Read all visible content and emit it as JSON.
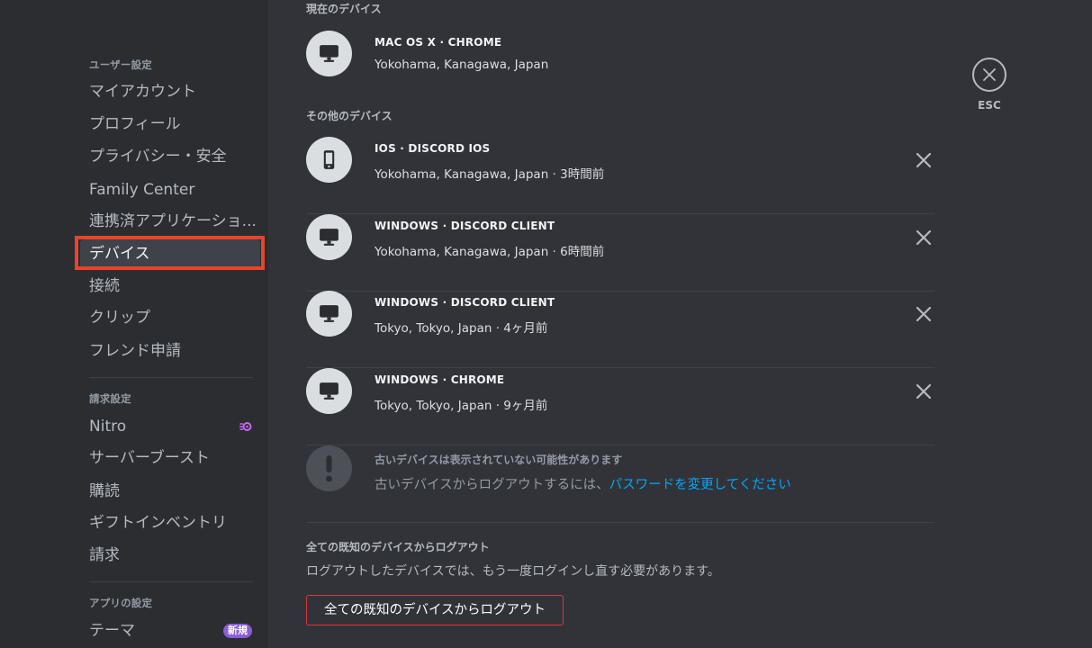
{
  "sidebar": {
    "user_settings_header": "ユーザー設定",
    "user_items": [
      {
        "label": "マイアカウント"
      },
      {
        "label": "プロフィール"
      },
      {
        "label": "プライバシー・安全"
      },
      {
        "label": "Family Center"
      },
      {
        "label": "連携済アプリケーショ..."
      },
      {
        "label": "デバイス",
        "active": true
      },
      {
        "label": "接続"
      },
      {
        "label": "クリップ"
      },
      {
        "label": "フレンド申請"
      }
    ],
    "billing_header": "請求設定",
    "billing_items": [
      {
        "label": "Nitro",
        "icon": "nitro-icon"
      },
      {
        "label": "サーバーブースト"
      },
      {
        "label": "購読"
      },
      {
        "label": "ギフトインベントリ"
      },
      {
        "label": "請求"
      }
    ],
    "app_settings_header": "アプリの設定",
    "app_items": [
      {
        "label": "テーマ",
        "badge": "新規"
      }
    ]
  },
  "main": {
    "current_device_header": "現在のデバイス",
    "current_device": {
      "name": "MAC OS X · CHROME",
      "location": "Yokohama, Kanagawa, Japan",
      "icon": "desktop-icon"
    },
    "other_devices_header": "その他のデバイス",
    "other_devices": [
      {
        "name": "IOS · DISCORD IOS",
        "location": "Yokohama, Kanagawa, Japan · 3時間前",
        "icon": "mobile-icon"
      },
      {
        "name": "WINDOWS · DISCORD CLIENT",
        "location": "Yokohama, Kanagawa, Japan · 6時間前",
        "icon": "desktop-icon"
      },
      {
        "name": "WINDOWS · DISCORD CLIENT",
        "location": "Tokyo, Tokyo, Japan · 4ヶ月前",
        "icon": "desktop-icon"
      },
      {
        "name": "WINDOWS · CHROME",
        "location": "Tokyo, Tokyo, Japan · 9ヶ月前",
        "icon": "desktop-icon"
      }
    ],
    "notice": {
      "title": "古いデバイスは表示されていない可能性があります",
      "body": "古いデバイスからログアウトするには、",
      "link": "パスワードを変更してください",
      "icon": "exclamation-icon"
    },
    "logout_all": {
      "header": "全ての既知のデバイスからログアウト",
      "description": "ログアウトしたデバイスでは、もう一度ログインし直す必要があります。",
      "button": "全ての既知のデバイスからログアウト"
    }
  },
  "esc": {
    "label": "ESC"
  },
  "colors": {
    "background": "#313338",
    "sidebar": "#2b2d31",
    "active_item": "#404249",
    "highlight_border": "#e8432d",
    "link": "#00a8fc",
    "danger": "#da373c",
    "badge": "#8a5cd6"
  }
}
